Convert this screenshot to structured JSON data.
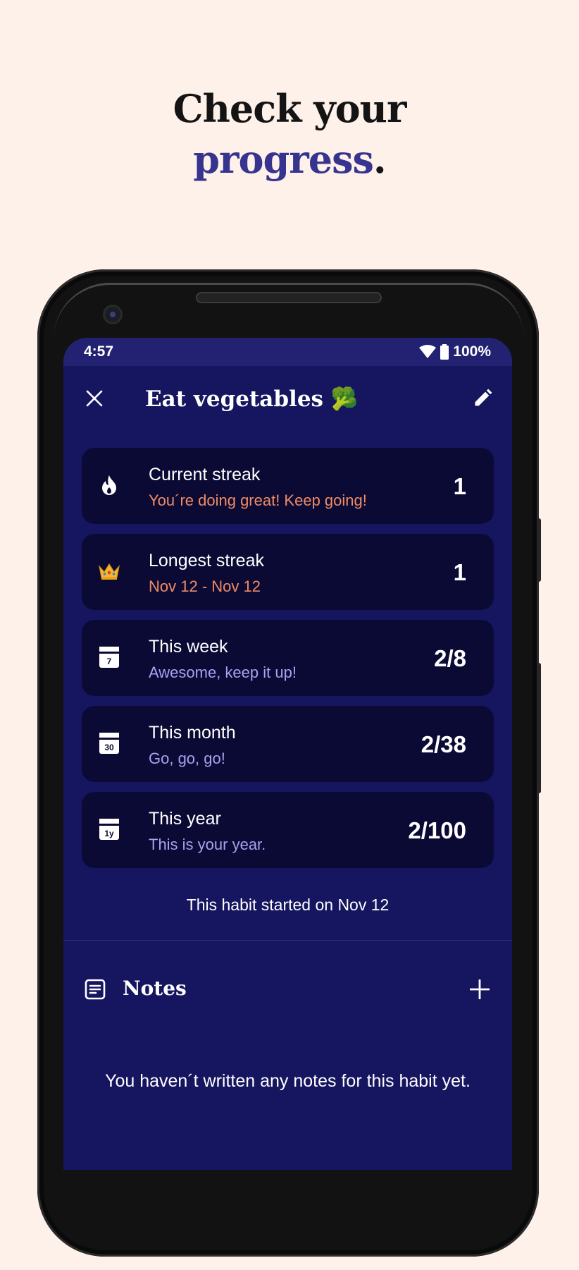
{
  "headline": {
    "line1": "Check your",
    "accent": "progress",
    "end": "."
  },
  "status": {
    "time": "4:57",
    "battery": "100%"
  },
  "toolbar": {
    "title": "Eat vegetables 🥦"
  },
  "stats": [
    {
      "title": "Current streak",
      "subtitle": "You´re doing great! Keep going!",
      "value": "1",
      "icon": "flame-icon",
      "subtitle_color": "#f08b63"
    },
    {
      "title": "Longest streak",
      "subtitle": "Nov 12 - Nov 12",
      "value": "1",
      "icon": "crown-icon",
      "subtitle_color": "#f08b63"
    },
    {
      "title": "This week",
      "subtitle": "Awesome, keep it up!",
      "value": "2/8",
      "icon": "calendar-week-icon",
      "icon_text": "7",
      "subtitle_color": "#a6a3f0"
    },
    {
      "title": "This month",
      "subtitle": "Go, go, go!",
      "value": "2/38",
      "icon": "calendar-month-icon",
      "icon_text": "30",
      "subtitle_color": "#a6a3f0"
    },
    {
      "title": "This year",
      "subtitle": "This is your year.",
      "value": "2/100",
      "icon": "calendar-year-icon",
      "icon_text": "1y",
      "subtitle_color": "#a6a3f0"
    }
  ],
  "started": "This habit started on Nov 12",
  "notes": {
    "title": "Notes",
    "empty": "You haven´t written any notes for this habit yet."
  },
  "colors": {
    "background": "#fdf1e9",
    "screen": "#161560",
    "card": "#0b0a35",
    "accent": "#36348f"
  }
}
